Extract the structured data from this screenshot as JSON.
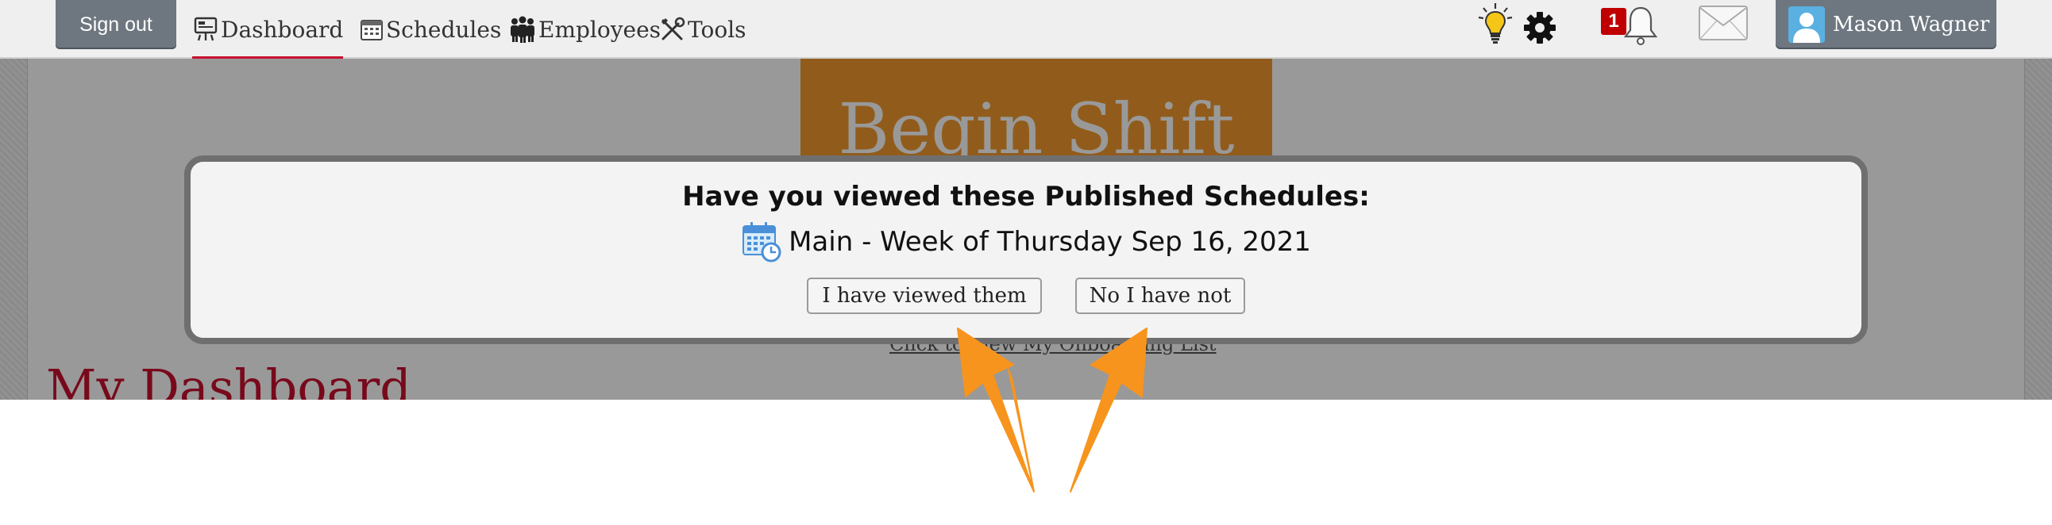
{
  "topbar": {
    "signout_label": "Sign out",
    "nav": [
      {
        "label": "Dashboard",
        "icon": "dashboard-icon",
        "active": true
      },
      {
        "label": "Schedules",
        "icon": "calendar-icon"
      },
      {
        "label": "Employees",
        "icon": "people-icon"
      },
      {
        "label": "Tools",
        "icon": "tools-icon"
      }
    ],
    "notification_count": "1",
    "user_name": "Mason Wagner"
  },
  "page": {
    "begin_shift_label": "Begin Shift",
    "onboarding_link": "Click to View My Onboarding List",
    "heading": "My Dashboard"
  },
  "modal": {
    "title": "Have you viewed these Published Schedules:",
    "schedule": "Main - Week of Thursday Sep 16, 2021",
    "confirm_label": "I have viewed them",
    "deny_label": "No I have not"
  },
  "colors": {
    "accent_red": "#c8102e",
    "begin_shift": "#f29a2e",
    "arrow_orange": "#f7941d",
    "badge_red": "#c00000"
  }
}
